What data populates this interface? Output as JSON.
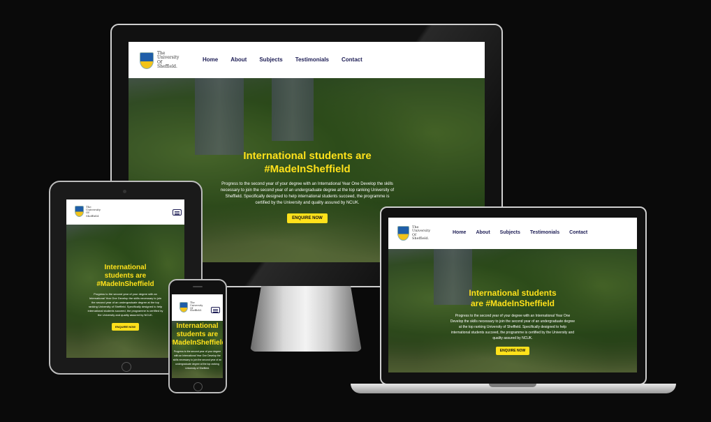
{
  "logo": {
    "line1": "The",
    "line2": "University",
    "line3": "Of",
    "line4": "Sheffield."
  },
  "nav": {
    "home": "Home",
    "about": "About",
    "subjects": "Subjects",
    "testimonials": "Testimonials",
    "contact": "Contact"
  },
  "hero": {
    "title_line1": "International students are",
    "title_line2": "#MadeInSheffield",
    "title_mid_a": "International",
    "title_mid_b": "students are",
    "title_lap_a": "International students",
    "title_lap_b": "are #MadeInSheffield",
    "title_phone_a": "International",
    "title_phone_b": "students are",
    "title_phone_c": "#MadeInSheffield",
    "body": "Progress to the second year of your degree with an International Year One Develop the skills necessary to join the second year of an undergraduate degree at the top ranking University of Sheffield. Specifically designed to help international students succeed, the programme is certified by the University and quality assured by NCUK.",
    "body_phone": "Progress to the second year of your degree with an International Year One Develop the skills necessary to join the second year of an undergraduate degree at the top ranking University of Sheffield.",
    "cta": "ENQUIRE NOW"
  },
  "colors": {
    "accent": "#ffe11b",
    "nav_text": "#1c1c54",
    "background": "#0a0a0a"
  },
  "icons": {
    "menu": "hamburger-menu-icon",
    "crest": "university-crest-icon"
  }
}
